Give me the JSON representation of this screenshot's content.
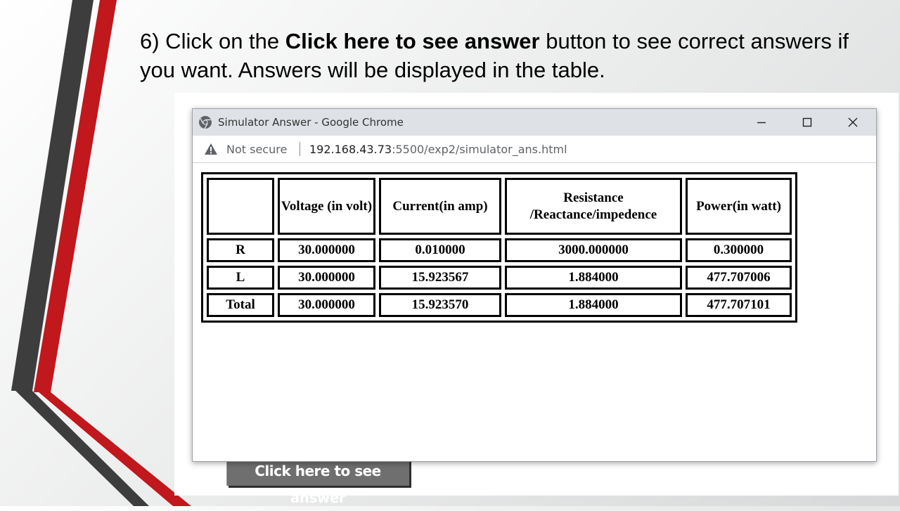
{
  "slide": {
    "instruction_prefix": "6) Click on the ",
    "instruction_bold": "Click here to see answer",
    "instruction_suffix": " button to see correct answers if you want. Answers will be displayed in the table.",
    "answer_button_label": "Click here to see answer"
  },
  "browser": {
    "window_title": "Simulator Answer - Google Chrome",
    "security_label": "Not secure",
    "url_host": "192.168.43.73",
    "url_rest": ":5500/exp2/simulator_ans.html",
    "controls": {
      "minimize": "minimize-icon",
      "maximize": "maximize-icon",
      "close": "close-icon"
    }
  },
  "table": {
    "headers": [
      "",
      "Voltage (in volt)",
      "Current(in amp)",
      "Resistance /Reactance/impedence",
      "Power(in watt)"
    ],
    "rows": [
      [
        "R",
        "30.000000",
        "0.010000",
        "3000.000000",
        "0.300000"
      ],
      [
        "L",
        "30.000000",
        "15.923567",
        "1.884000",
        "477.707006"
      ],
      [
        "Total",
        "30.000000",
        "15.923570",
        "1.884000",
        "477.707101"
      ]
    ]
  },
  "colors": {
    "accent_red": "#c0181c",
    "accent_dark": "#3a3a3a",
    "titlebar": "#dee1e6",
    "button_bg": "#6f6f6f"
  }
}
